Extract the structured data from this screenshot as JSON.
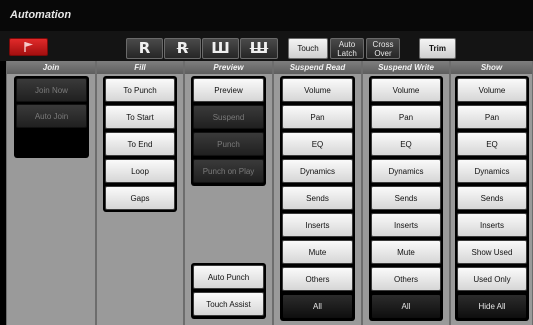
{
  "window": {
    "title": "Automation"
  },
  "toolbar": {
    "mode_buttons": [
      "Touch",
      "Auto Latch",
      "Cross Over"
    ],
    "trim_label": "Trim"
  },
  "join": {
    "header": "Join",
    "buttons": [
      "Join Now",
      "Auto Join"
    ]
  },
  "fill": {
    "header": "Fill",
    "buttons": [
      "To Punch",
      "To Start",
      "To End",
      "Loop",
      "Gaps"
    ]
  },
  "preview": {
    "header": "Preview",
    "buttons": [
      "Preview",
      "Suspend",
      "Punch",
      "Punch on Play"
    ],
    "bottom_buttons": [
      "Auto Punch",
      "Touch Assist"
    ]
  },
  "suspend_read": {
    "header": "Suspend Read",
    "buttons": [
      "Volume",
      "Pan",
      "EQ",
      "Dynamics",
      "Sends",
      "Inserts",
      "Mute",
      "Others"
    ],
    "all_label": "All"
  },
  "suspend_write": {
    "header": "Suspend Write",
    "buttons": [
      "Volume",
      "Pan",
      "EQ",
      "Dynamics",
      "Sends",
      "Inserts",
      "Mute",
      "Others"
    ],
    "all_label": "All"
  },
  "show": {
    "header": "Show",
    "buttons": [
      "Volume",
      "Pan",
      "EQ",
      "Dynamics",
      "Sends",
      "Inserts",
      "Show Used",
      "Used Only"
    ],
    "hide_all_label": "Hide All"
  },
  "colors": {
    "accent_red": "#d11b1b",
    "panel_grey": "#9a9a9a",
    "title_bar": "#080808"
  }
}
